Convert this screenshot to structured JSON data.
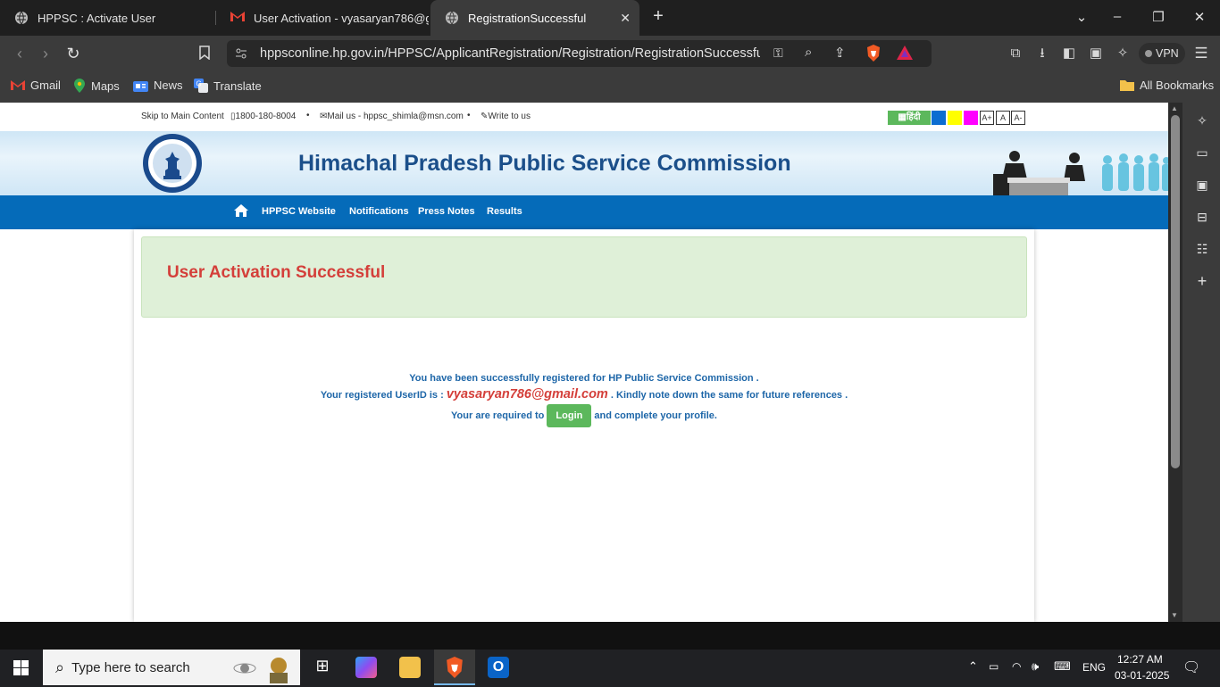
{
  "browser": {
    "tabs": [
      {
        "title": "HPPSC : Activate User"
      },
      {
        "title": "User Activation - vyasaryan786@gm"
      },
      {
        "title": "RegistrationSuccessful"
      }
    ],
    "new_tab_symbol": "+",
    "url": "hppsconline.hp.gov.in/HPPSC/ApplicantRegistration/Registration/RegistrationSuccessful?...",
    "vpn_label": "VPN",
    "bookmarks": [
      {
        "label": "Gmail"
      },
      {
        "label": "Maps"
      },
      {
        "label": "News"
      },
      {
        "label": "Translate"
      }
    ],
    "all_bookmarks": "All Bookmarks"
  },
  "site": {
    "top_links": {
      "skip": "Skip to Main Content",
      "phone": "1800-180-8004",
      "mail": "Mail us - hppsc_shimla@msn.com",
      "write": "Write to us",
      "separator": "•"
    },
    "hindi_label": "हिंदी",
    "font_buttons": [
      "A+",
      "A",
      "A-"
    ],
    "theme_colors": [
      "#0b6dd1",
      "#ffff00",
      "#ff00ff"
    ],
    "title": "Himachal Pradesh Public Service Commission",
    "nav": [
      {
        "label": "HPPSC Website"
      },
      {
        "label": "Notifications"
      },
      {
        "label": "Press Notes"
      },
      {
        "label": "Results"
      }
    ],
    "alert_title": "User Activation Successful",
    "message": {
      "line1": "You have been successfully registered for HP Public Service Commission .",
      "line2_prefix": "Your registered UserID is :",
      "user_id": "vyasaryan786@gmail.com",
      "line2_suffix": ". Kindly note down the same for future references .",
      "line3_prefix": "Your are required to",
      "login_button": "Login",
      "line3_suffix": "and complete your profile."
    }
  },
  "taskbar": {
    "search_placeholder": "Type here to search",
    "language": "ENG",
    "time": "12:27 AM",
    "date": "03-01-2025"
  },
  "colors": {
    "nav_blue": "#056bb9",
    "alert_bg": "#dff0d8",
    "alert_text": "#d43f3a",
    "message_blue": "#1d66a8",
    "login_green": "#5cb85c",
    "title_blue": "#1b4f8a"
  }
}
